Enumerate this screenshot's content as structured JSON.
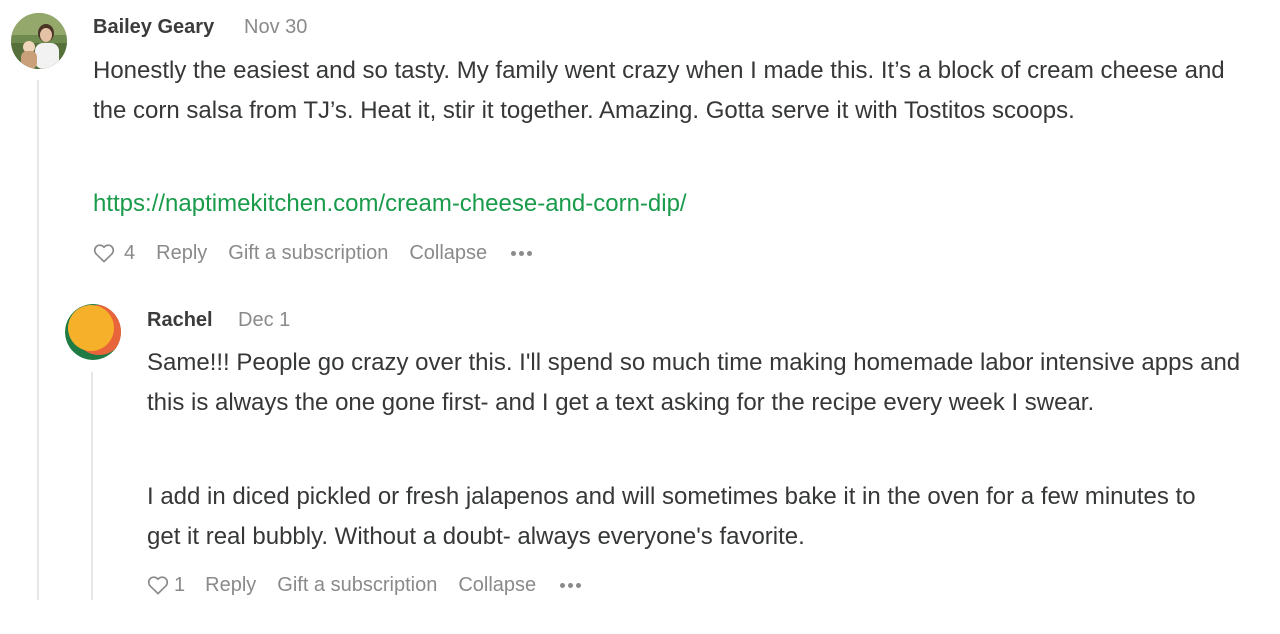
{
  "comments": [
    {
      "author": "Bailey Geary",
      "date": "Nov 30",
      "paragraphs": [
        "Honestly the easiest and so tasty. My family went crazy when I made this. It’s a block of cream cheese and the corn salsa from TJ’s. Heat it, stir it together. Amazing. Gotta serve it with Tostitos scoops."
      ],
      "link": "https://naptimekitchen.com/cream-cheese-and-corn-dip/",
      "likes": "4",
      "actions": {
        "reply": "Reply",
        "gift": "Gift a subscription",
        "collapse": "Collapse"
      },
      "avatar_icon": "user-photo-icon"
    },
    {
      "author": "Rachel",
      "date": "Dec 1",
      "paragraphs": [
        "Same!!! People go crazy over this. I'll spend so much time making homemade labor intensive apps and this is always the one gone first- and I get a text asking for the recipe every week I swear.",
        "I add in diced pickled or fresh jalapenos and will sometimes bake it in the oven for a few minutes to get it real bubbly. Without a doubt- always everyone's favorite."
      ],
      "likes": "1",
      "actions": {
        "reply": "Reply",
        "gift": "Gift a subscription",
        "collapse": "Collapse"
      },
      "avatar_icon": "generated-avatar-icon"
    }
  ],
  "colors": {
    "link": "#1a9b4b",
    "text": "#363737",
    "muted": "#8a8a8a",
    "thread_line": "#e6e6e6"
  }
}
